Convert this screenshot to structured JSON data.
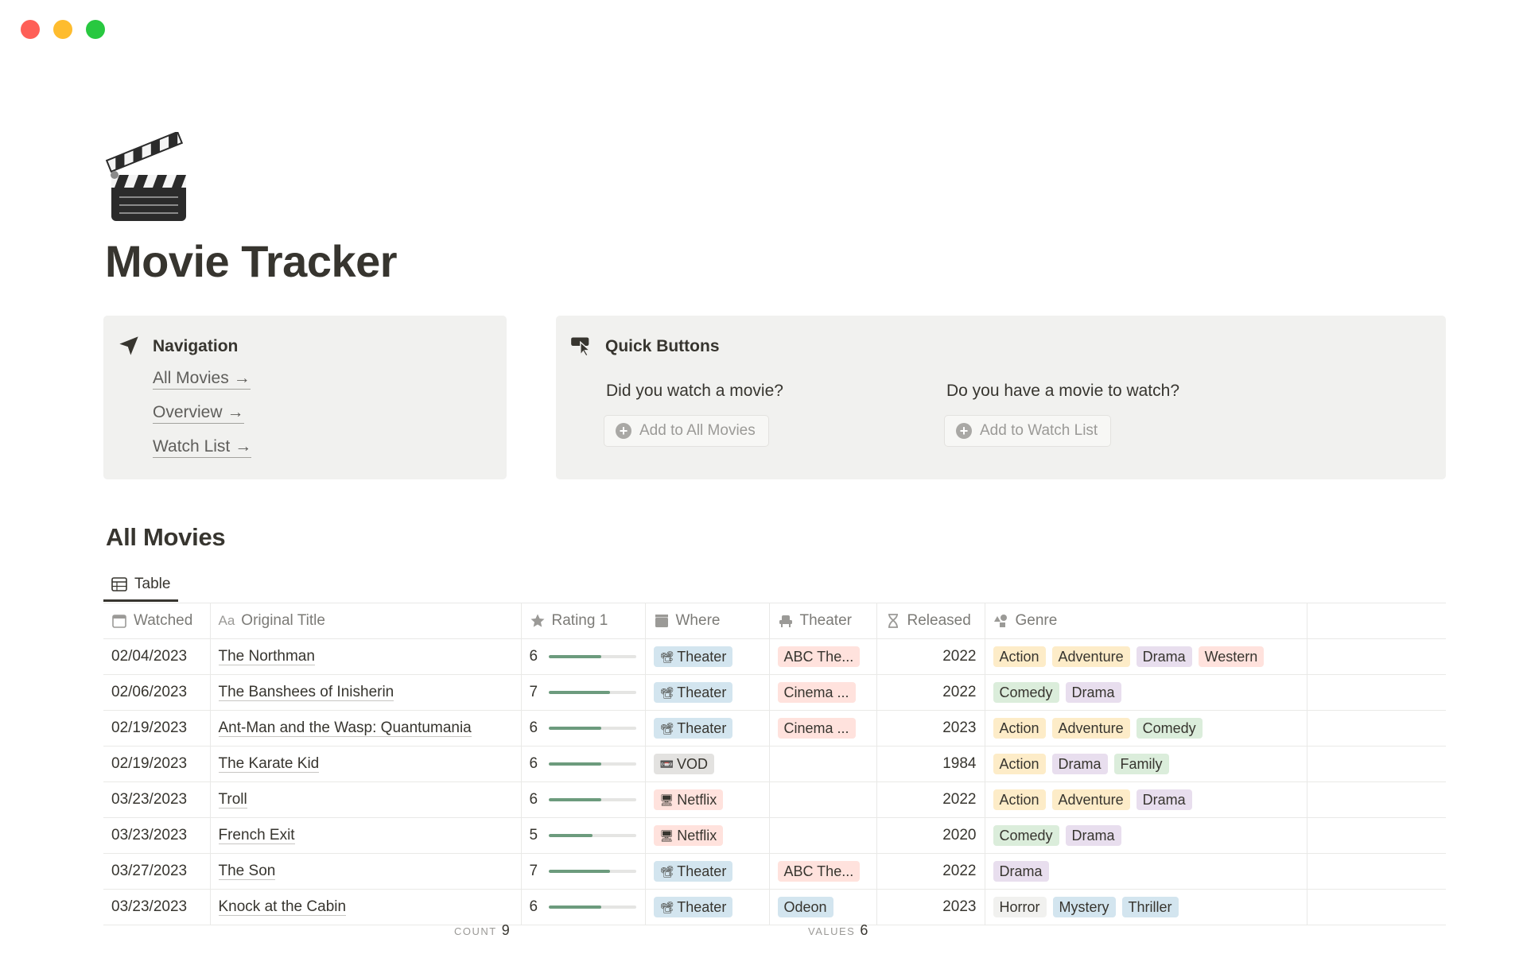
{
  "page": {
    "title": "Movie Tracker",
    "icon": "clapper-board-icon"
  },
  "navigation": {
    "heading": "Navigation",
    "icon": "navigation-arrow-icon",
    "links": [
      {
        "label": "All Movies",
        "arrow": "→"
      },
      {
        "label": "Overview",
        "arrow": "→"
      },
      {
        "label": "Watch List",
        "arrow": "→"
      }
    ]
  },
  "quick": {
    "heading": "Quick Buttons",
    "icon": "cursor-click-icon",
    "col1": {
      "label": "Did you watch a movie?",
      "button": "Add to All Movies"
    },
    "col2": {
      "label": "Do you have a movie to watch?",
      "button": "Add to Watch List"
    }
  },
  "section": {
    "title": "All Movies",
    "view_tab": "Table"
  },
  "table": {
    "headers": {
      "watched": "Watched",
      "title_prefix": "Aa",
      "title": "Original Title",
      "rating": "Rating 1",
      "where": "Where",
      "theater": "Theater",
      "released": "Released",
      "genre": "Genre"
    },
    "rows": [
      {
        "watched": "02/04/2023",
        "title": "The Northman",
        "rating": 6,
        "rating_fraction": 0.6,
        "where": "Theater",
        "where_icon": "📽",
        "where_color": "#d3e5ef",
        "theater": "ABC The...",
        "theater_color": "#ffe2dd",
        "released": "2022",
        "genres": [
          [
            "Action",
            "#fdecc8"
          ],
          [
            "Adventure",
            "#fdecc8"
          ],
          [
            "Drama",
            "#e8deee"
          ],
          [
            "Western",
            "#ffe2dd"
          ]
        ]
      },
      {
        "watched": "02/06/2023",
        "title": "The Banshees of Inisherin",
        "rating": 7,
        "rating_fraction": 0.7,
        "where": "Theater",
        "where_icon": "📽",
        "where_color": "#d3e5ef",
        "theater": "Cinema ...",
        "theater_color": "#ffe2dd",
        "released": "2022",
        "genres": [
          [
            "Comedy",
            "#dbeddb"
          ],
          [
            "Drama",
            "#e8deee"
          ]
        ]
      },
      {
        "watched": "02/19/2023",
        "title": "Ant-Man and the Wasp: Quantumania",
        "rating": 6,
        "rating_fraction": 0.6,
        "where": "Theater",
        "where_icon": "📽",
        "where_color": "#d3e5ef",
        "theater": "Cinema ...",
        "theater_color": "#ffe2dd",
        "released": "2023",
        "genres": [
          [
            "Action",
            "#fdecc8"
          ],
          [
            "Adventure",
            "#fdecc8"
          ],
          [
            "Comedy",
            "#dbeddb"
          ]
        ]
      },
      {
        "watched": "02/19/2023",
        "title": "The Karate Kid",
        "rating": 6,
        "rating_fraction": 0.6,
        "where": "VOD",
        "where_icon": "📼",
        "where_color": "#e3e2e0",
        "theater": "",
        "theater_color": "",
        "released": "1984",
        "genres": [
          [
            "Action",
            "#fdecc8"
          ],
          [
            "Drama",
            "#e8deee"
          ],
          [
            "Family",
            "#dbeddb"
          ]
        ]
      },
      {
        "watched": "03/23/2023",
        "title": "Troll",
        "rating": 6,
        "rating_fraction": 0.6,
        "where": "Netflix",
        "where_icon": "🖥",
        "where_color": "#ffe2dd",
        "theater": "",
        "theater_color": "",
        "released": "2022",
        "genres": [
          [
            "Action",
            "#fdecc8"
          ],
          [
            "Adventure",
            "#fdecc8"
          ],
          [
            "Drama",
            "#e8deee"
          ]
        ]
      },
      {
        "watched": "03/23/2023",
        "title": "French Exit",
        "rating": 5,
        "rating_fraction": 0.5,
        "where": "Netflix",
        "where_icon": "🖥",
        "where_color": "#ffe2dd",
        "theater": "",
        "theater_color": "",
        "released": "2020",
        "genres": [
          [
            "Comedy",
            "#dbeddb"
          ],
          [
            "Drama",
            "#e8deee"
          ]
        ]
      },
      {
        "watched": "03/27/2023",
        "title": "The Son",
        "rating": 7,
        "rating_fraction": 0.7,
        "where": "Theater",
        "where_icon": "📽",
        "where_color": "#d3e5ef",
        "theater": "ABC The...",
        "theater_color": "#ffe2dd",
        "released": "2022",
        "genres": [
          [
            "Drama",
            "#e8deee"
          ]
        ]
      },
      {
        "watched": "03/23/2023",
        "title": "Knock at the Cabin",
        "rating": 6,
        "rating_fraction": 0.6,
        "where": "Theater",
        "where_icon": "📽",
        "where_color": "#d3e5ef",
        "theater": "Odeon",
        "theater_color": "#d3e5ef",
        "released": "2023",
        "genres": [
          [
            "Horror",
            "#f1f1ef"
          ],
          [
            "Mystery",
            "#d3e5ef"
          ],
          [
            "Thriller",
            "#d3e5ef"
          ]
        ]
      }
    ]
  },
  "footer": {
    "count_label": "COUNT",
    "count_value": "9",
    "values_label": "VALUES",
    "values_value": "6"
  },
  "colors": {
    "text": "#37352f",
    "muted": "#9b9a97",
    "callout_bg": "#f1f1ef",
    "rating_bar": "#6c9b7d"
  }
}
